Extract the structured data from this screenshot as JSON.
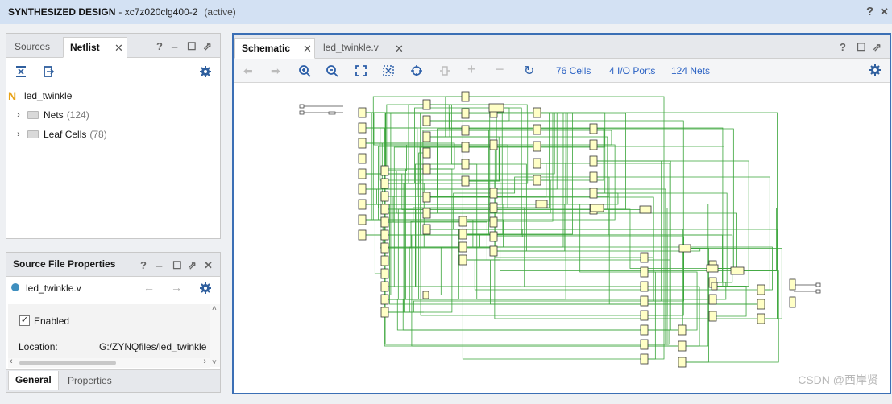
{
  "title": {
    "design": "SYNTHESIZED DESIGN",
    "part": "- xc7z020clg400-2",
    "state": "(active)",
    "help": "?",
    "close": "✕"
  },
  "netlist_panel": {
    "tabs": [
      "Sources",
      "Netlist"
    ],
    "close": "✕",
    "controls": [
      "?",
      "_",
      "☐",
      "⇗"
    ],
    "root": {
      "icon": "N",
      "label": "led_twinkle"
    },
    "items": [
      {
        "label": "Nets",
        "count": "(124)"
      },
      {
        "label": "Leaf Cells",
        "count": "(78)"
      }
    ]
  },
  "props_panel": {
    "title": "Source File Properties",
    "controls": [
      "?",
      "_",
      "☐",
      "⇗",
      "✕"
    ],
    "file": "led_twinkle.v",
    "enabled_label": "Enabled",
    "location_label": "Location:",
    "location_value": "G:/ZYNQfiles/led_twinkle",
    "tabs": [
      "General",
      "Properties"
    ]
  },
  "schematic_panel": {
    "tabs": [
      "Schematic",
      "led_twinkle.v"
    ],
    "close": "✕",
    "controls": [
      "?",
      "☐",
      "⇗"
    ],
    "stats": {
      "cells": "76 Cells",
      "ports": "4 I/O Ports",
      "nets": "124 Nets"
    }
  },
  "watermark": "CSDN @西岸贤",
  "colors": {
    "wire": "#3aa53a",
    "cell_fill": "#ffffc6",
    "accent_blue": "#3b6fb5"
  }
}
